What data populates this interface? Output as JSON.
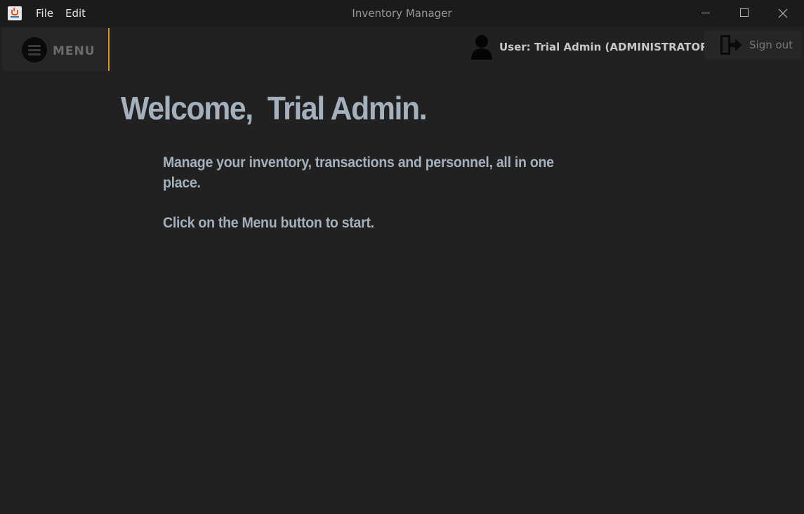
{
  "window": {
    "title": "Inventory Manager",
    "menus": [
      "File",
      "Edit"
    ]
  },
  "header": {
    "menu_label": "MENU",
    "user_label": "User: Trial Admin (ADMINISTRATOR)",
    "signout_label": "Sign out"
  },
  "main": {
    "welcome": "Welcome,  Trial Admin.",
    "description": "Manage your inventory, transactions and personnel, all in one place.",
    "instruction": "Click on the Menu button to start."
  },
  "colors": {
    "background": "#212121",
    "accent": "#d4932a",
    "text": "#a4b1bd"
  },
  "icons": [
    "java-app-icon",
    "hamburger-icon",
    "user-icon",
    "signout-icon"
  ]
}
